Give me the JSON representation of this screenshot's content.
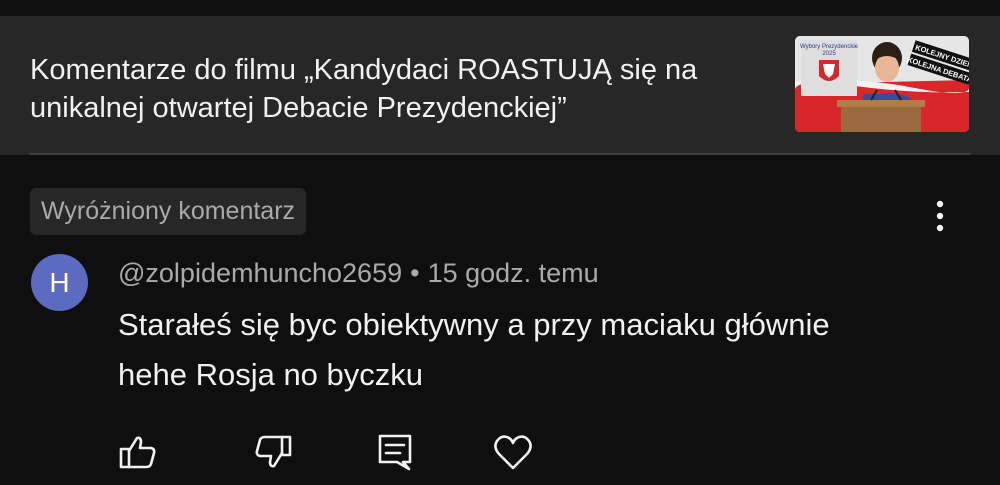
{
  "header": {
    "title_line1": "Komentarze do filmu „Kandydaci ROASTUJĄ się na",
    "title_line2": "unikalnej otwartej Debacie Prezydenckiej”",
    "thumbnail": {
      "header_text": "Wybory Prezydenckie",
      "year": "2025",
      "sticker_line1": "KOLEJNY DZIEŃ",
      "sticker_line2": "KOLEJNA DEBATA"
    }
  },
  "comment": {
    "badge": "Wyróżniony komentarz",
    "avatar_letter": "H",
    "author": "@zolpidemhuncho2659",
    "separator": "•",
    "time": "15 godz. temu",
    "text_line1": "Starałeś się byc obiektywny a przy maciaku głównie",
    "text_line2": "hehe Rosja no byczku",
    "avatar_color": "#5c6bc0"
  },
  "actions": {
    "icons": [
      "like-icon",
      "dislike-icon",
      "reply-icon",
      "heart-icon",
      "more-options-icon"
    ]
  }
}
